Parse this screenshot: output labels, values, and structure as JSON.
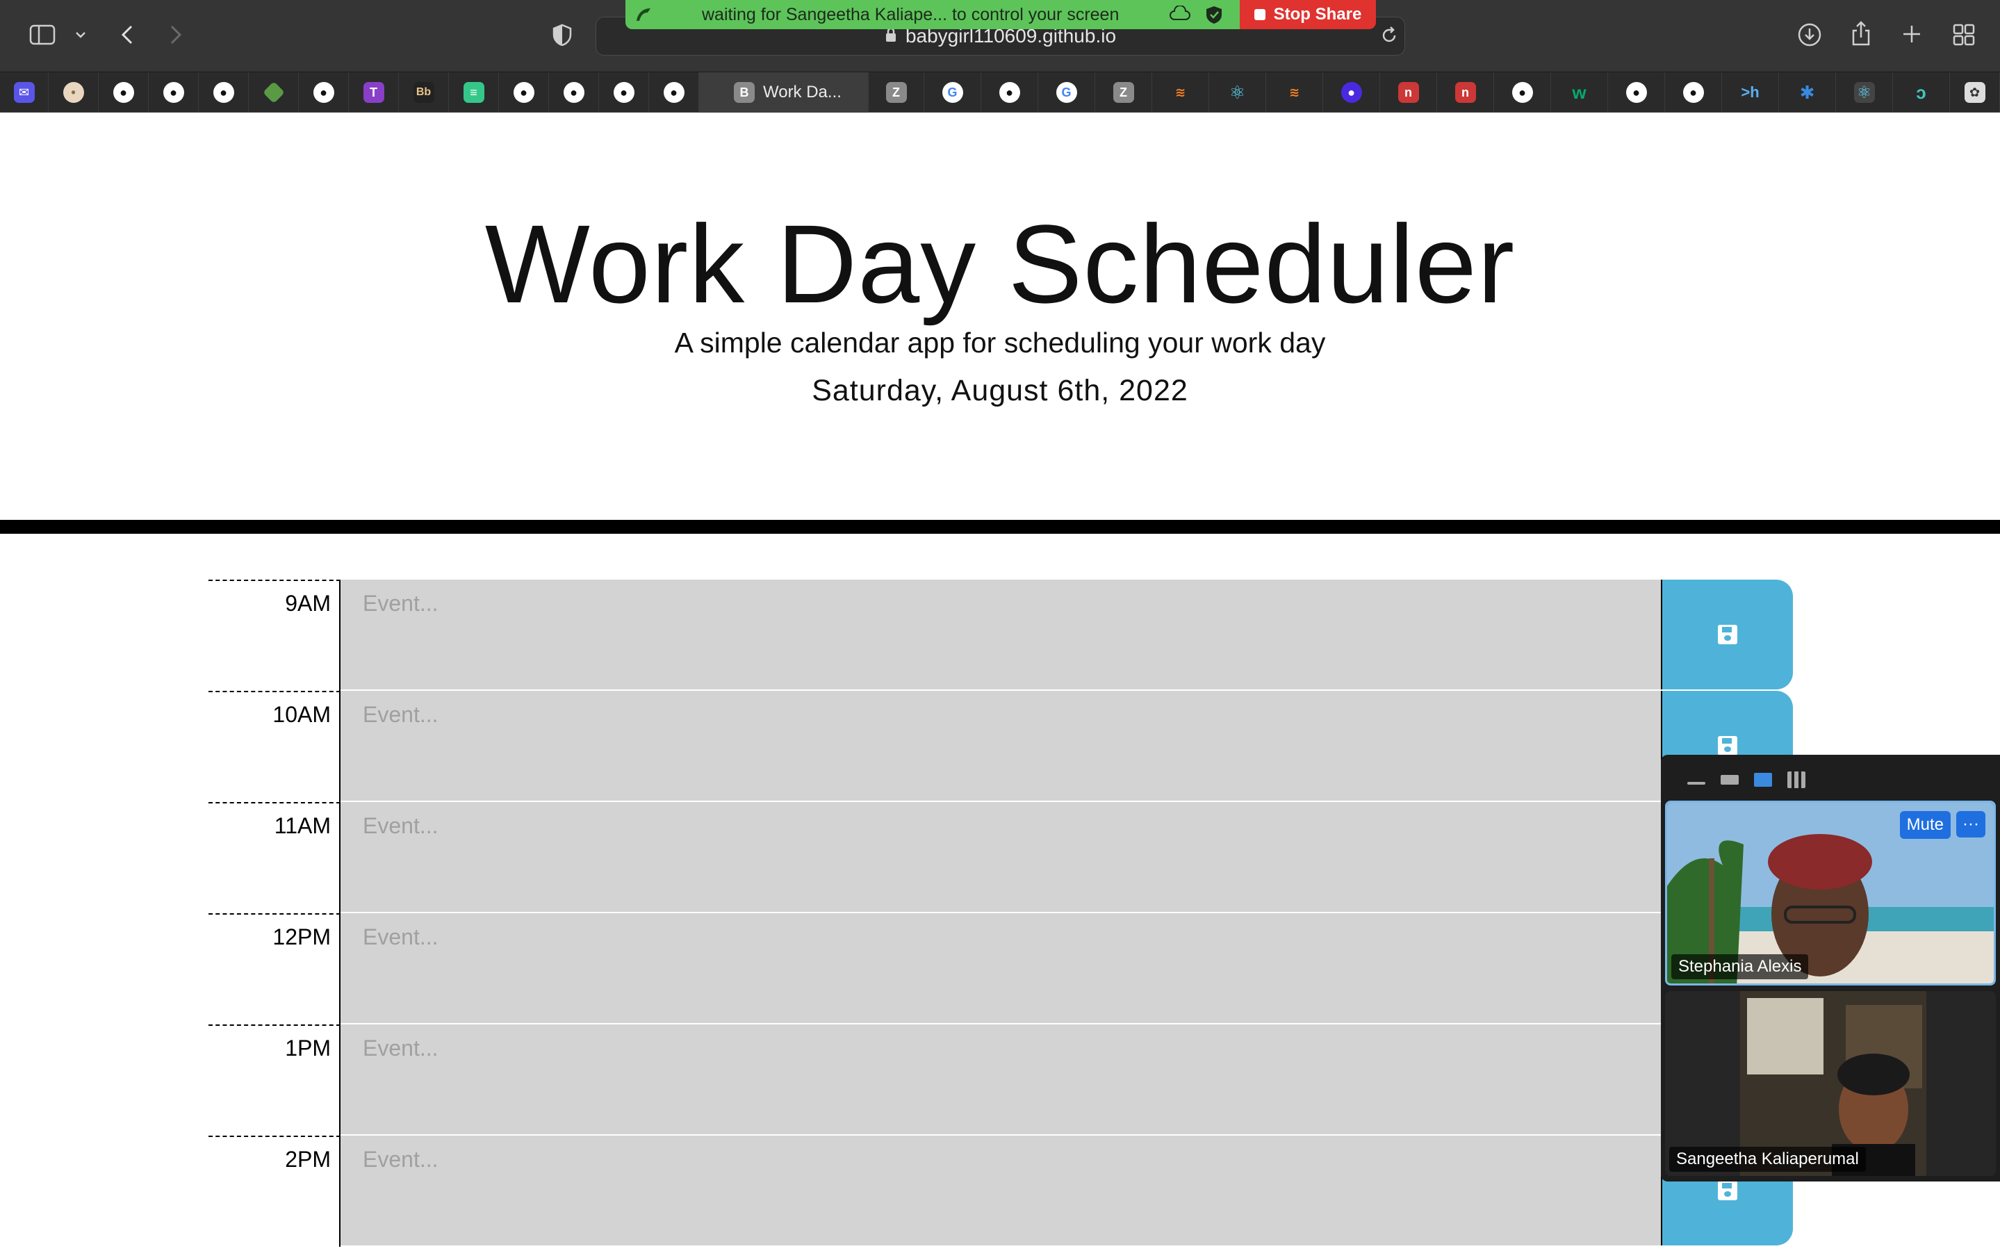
{
  "browser": {
    "url": "babygirl110609.github.io",
    "active_tab_label": "Work Da...",
    "tab_badge_letter": "B",
    "zoom_tab_letter": "Z",
    "google_letter": "G",
    "hyper_label": ">h",
    "bb_label": "Bb",
    "w_label": "w"
  },
  "share_banner": {
    "message": "waiting for Sangeetha Kaliape... to control your screen",
    "stop_label": "Stop Share"
  },
  "page": {
    "title": "Work Day Scheduler",
    "subtitle": "A simple calendar app for scheduling your work day",
    "date": "Saturday, August 6th, 2022"
  },
  "schedule": {
    "placeholder": "Event...",
    "hours": [
      "9AM",
      "10AM",
      "11AM",
      "12PM",
      "1PM",
      "2PM"
    ]
  },
  "meeting": {
    "participants": [
      {
        "name": "Stephania Alexis"
      },
      {
        "name": "Sangeetha Kaliaperumal"
      }
    ],
    "mute_label": "Mute",
    "more_label": "···"
  },
  "colors": {
    "past": "#d3d3d3",
    "save": "#4fb3d9",
    "share_green": "#5dc45a",
    "share_red": "#e0322f"
  }
}
